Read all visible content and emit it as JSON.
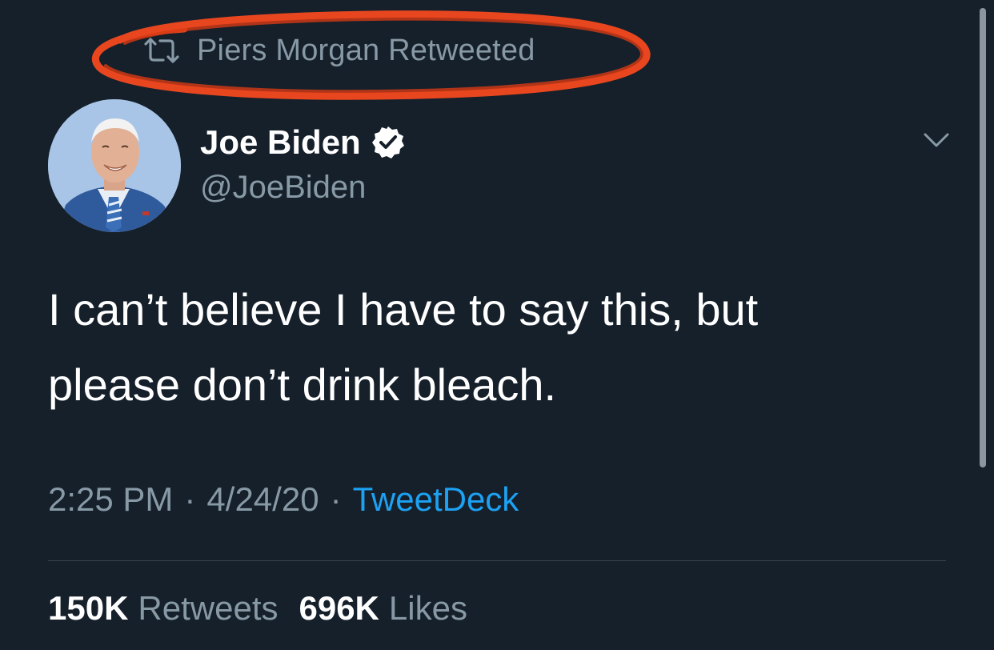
{
  "retweet_context": {
    "icon": "retweet-icon",
    "text": "Piers Morgan Retweeted",
    "annotation_color": "#e8461f"
  },
  "author": {
    "display_name": "Joe Biden",
    "handle": "@JoeBiden",
    "verified_icon": "verified-badge-icon",
    "avatar": "profile-photo"
  },
  "menu_icon": "chevron-down-icon",
  "tweet": {
    "line1": "I can’t believe I have to say this, but",
    "line2": "please don’t drink bleach."
  },
  "meta": {
    "time": "2:25 PM",
    "separator": "·",
    "date": "4/24/20",
    "source": "TweetDeck"
  },
  "stats": {
    "retweets_count": "150K",
    "retweets_label": "Retweets",
    "likes_count": "696K",
    "likes_label": "Likes"
  },
  "colors": {
    "background": "#15202b",
    "primary_text": "#ffffff",
    "secondary_text": "#8899a6",
    "link": "#1da1f2",
    "divider": "#38444d"
  }
}
